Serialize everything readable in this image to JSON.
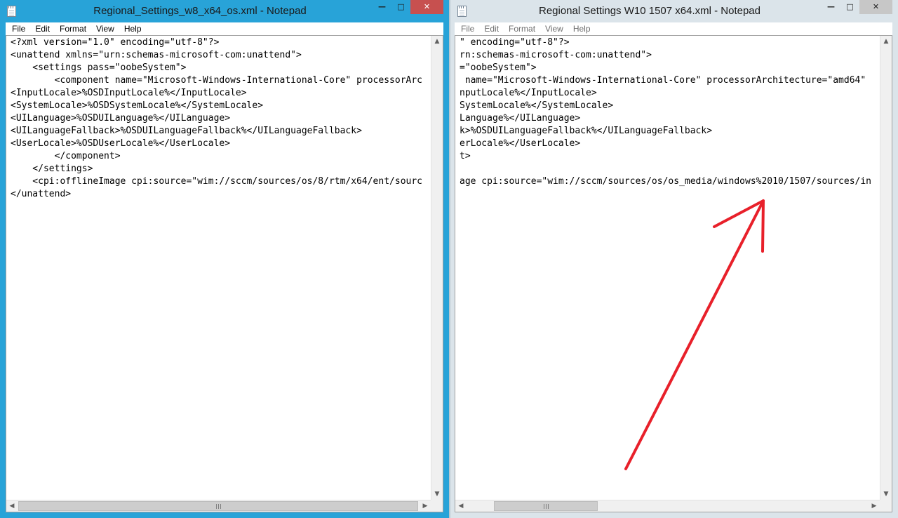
{
  "left_window": {
    "title": "Regional_Settings_w8_x64_os.xml - Notepad",
    "menu": [
      "File",
      "Edit",
      "Format",
      "View",
      "Help"
    ],
    "controls": {
      "minimize": "—",
      "maximize": "□",
      "close": "✕"
    },
    "lines": [
      "<?xml version=\"1.0\" encoding=\"utf-8\"?>",
      "<unattend xmlns=\"urn:schemas-microsoft-com:unattend\">",
      "    <settings pass=\"oobeSystem\">",
      "        <component name=\"Microsoft-Windows-International-Core\" processorArc",
      "<InputLocale>%OSDInputLocale%</InputLocale>",
      "<SystemLocale>%OSDSystemLocale%</SystemLocale>",
      "<UILanguage>%OSDUILanguage%</UILanguage>",
      "<UILanguageFallback>%OSDUILanguageFallback%</UILanguageFallback>",
      "<UserLocale>%OSDUserLocale%</UserLocale>",
      "        </component>",
      "    </settings>",
      "    <cpi:offlineImage cpi:source=\"wim://sccm/sources/os/8/rtm/x64/ent/sourc",
      "</unattend>"
    ],
    "scroll": {
      "up": "▲",
      "down": "▼",
      "left": "◀",
      "right": "▶"
    }
  },
  "right_window": {
    "title": "Regional Settings W10 1507 x64.xml - Notepad",
    "menu": [
      "File",
      "Edit",
      "Format",
      "View",
      "Help"
    ],
    "controls": {
      "minimize": "—",
      "maximize": "□",
      "close": "✕"
    },
    "lines": [
      "\" encoding=\"utf-8\"?>",
      "rn:schemas-microsoft-com:unattend\">",
      "=\"oobeSystem\">",
      " name=\"Microsoft-Windows-International-Core\" processorArchitecture=\"amd64\"",
      "nputLocale%</InputLocale>",
      "SystemLocale%</SystemLocale>",
      "Language%</UILanguage>",
      "k>%OSDUILanguageFallback%</UILanguageFallback>",
      "erLocale%</UserLocale>",
      "t>",
      "",
      "age cpi:source=\"wim://sccm/sources/os/os_media/windows%2010/1507/sources/in"
    ],
    "scroll": {
      "up": "▲",
      "down": "▼",
      "left": "◀",
      "right": "▶"
    }
  },
  "annotation": {
    "arrow_color": "#e8202a"
  }
}
